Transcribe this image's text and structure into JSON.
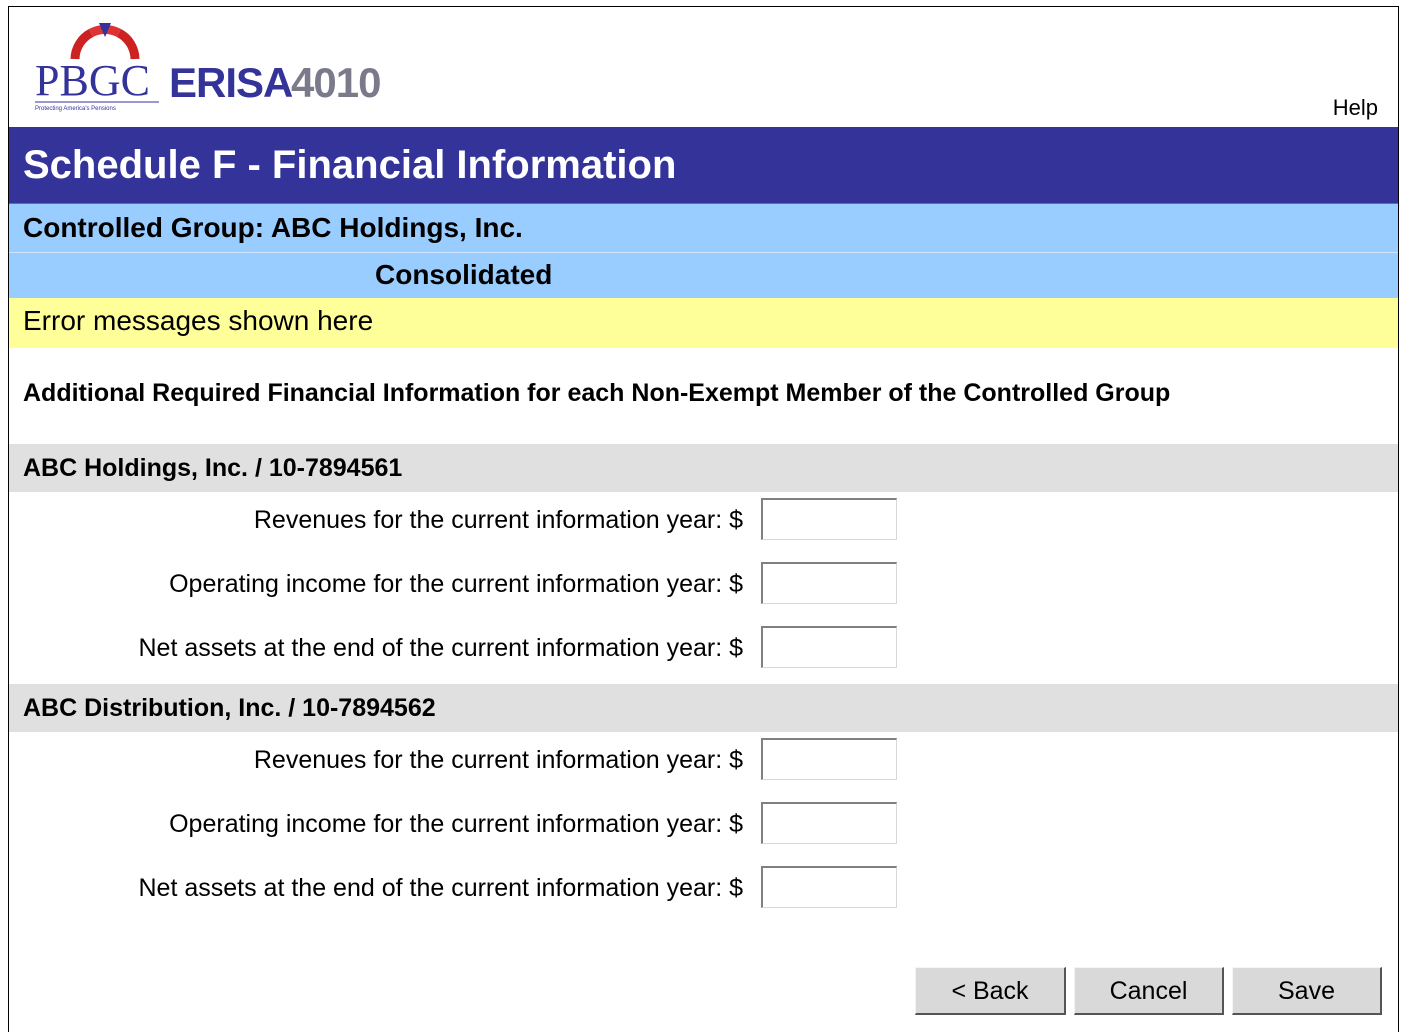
{
  "header": {
    "logo_text": "PBGC",
    "logo_product": "ERISA 4010",
    "logo_tagline": "Protecting America's Pensions",
    "help_label": "Help"
  },
  "page": {
    "title": "Schedule F  - Financial Information",
    "controlled_group": "Controlled Group: ABC Holdings, Inc.",
    "consolidated": "Consolidated",
    "error_message": "Error messages shown here",
    "intro": "Additional Required Financial Information for each Non-Exempt Member of the Controlled Group"
  },
  "members": [
    {
      "heading": "ABC Holdings, Inc. / 10-7894561",
      "fields": [
        {
          "label": "Revenues for the current information year: $",
          "value": ""
        },
        {
          "label": "Operating income for the current information year: $",
          "value": ""
        },
        {
          "label": "Net assets at the end of the current information year: $",
          "value": ""
        }
      ]
    },
    {
      "heading": "ABC Distribution, Inc. / 10-7894562",
      "fields": [
        {
          "label": "Revenues for the current information year: $",
          "value": ""
        },
        {
          "label": "Operating income for the current information year: $",
          "value": ""
        },
        {
          "label": "Net assets at the end of the current information year: $",
          "value": ""
        }
      ]
    }
  ],
  "actions": {
    "back_label": "< Back",
    "cancel_label": "Cancel",
    "save_label": "Save"
  },
  "colors": {
    "title_bar": "#333399",
    "group_bar": "#99ccff",
    "error_bar": "#ffff99",
    "member_header": "#e0e0e0"
  }
}
